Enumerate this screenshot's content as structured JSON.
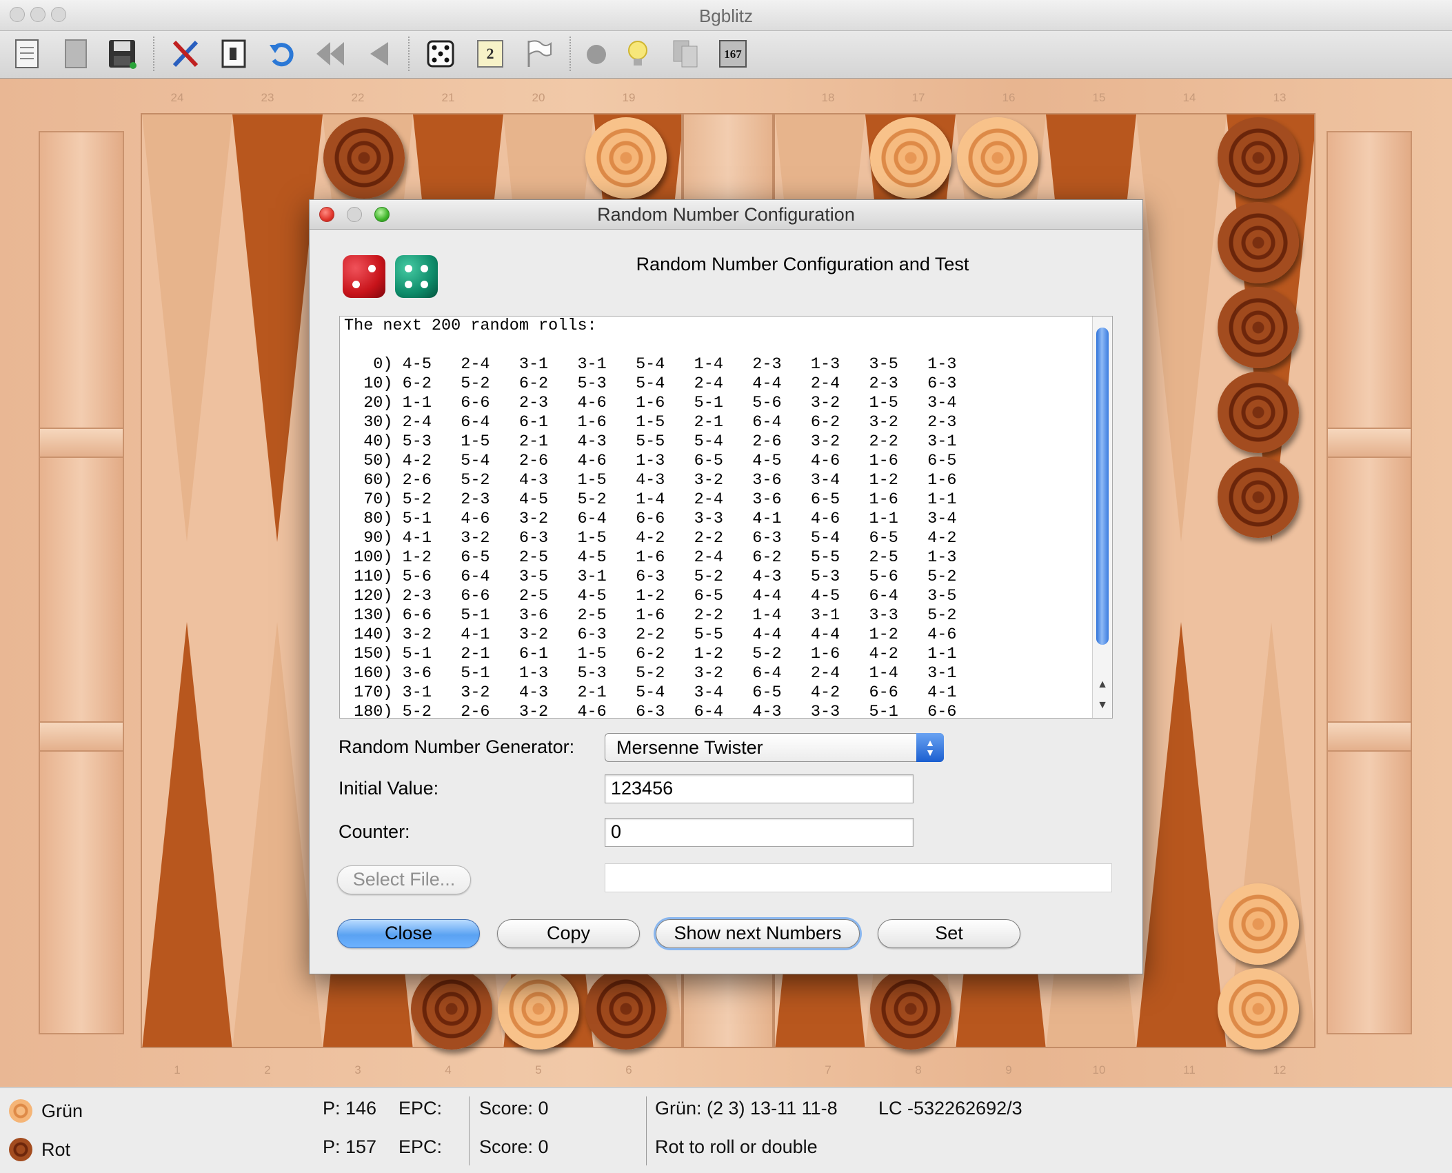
{
  "window": {
    "title": "Bgblitz"
  },
  "toolbar": {
    "items": [
      {
        "icon": "new-document-icon"
      },
      {
        "icon": "open-document-icon"
      },
      {
        "icon": "save-disk-icon"
      },
      {
        "icon": "tools-settings-icon"
      },
      {
        "icon": "board-view-icon"
      },
      {
        "icon": "undo-icon"
      },
      {
        "icon": "rewind-icon"
      },
      {
        "icon": "step-back-icon"
      },
      {
        "icon": "roll-dice-icon"
      },
      {
        "icon": "double-cube-icon",
        "label": "2"
      },
      {
        "icon": "resign-flag-icon"
      },
      {
        "icon": "circle-icon"
      },
      {
        "icon": "hint-lightbulb-icon"
      },
      {
        "icon": "copy-icon"
      },
      {
        "icon": "counter-icon",
        "label": "167"
      }
    ]
  },
  "board": {
    "top_points": [
      "24",
      "23",
      "22",
      "21",
      "20",
      "19",
      "18",
      "17",
      "16",
      "15",
      "14",
      "13"
    ],
    "bottom_points": [
      "1",
      "2",
      "3",
      "4",
      "5",
      "6",
      "7",
      "8",
      "9",
      "10",
      "11",
      "12"
    ],
    "colors": {
      "dark_checker": "#8a3a12",
      "light_checker": "#f0a86a",
      "turn_indicator": "#e0140c"
    }
  },
  "dialog": {
    "title": "Random Number Configuration",
    "heading": "Random Number Configuration and Test",
    "dice": [
      {
        "color": "#c8141b",
        "face": 2,
        "icon": "red-die-icon"
      },
      {
        "color": "#0e8c6a",
        "face": 4,
        "icon": "green-die-icon"
      }
    ],
    "rolls_header": "The next 200 random rolls:",
    "rolls": [
      {
        "index": "  0)",
        "values": [
          "4-5",
          "2-4",
          "3-1",
          "3-1",
          "5-4",
          "1-4",
          "2-3",
          "1-3",
          "3-5",
          "1-3"
        ]
      },
      {
        "index": " 10)",
        "values": [
          "6-2",
          "5-2",
          "6-2",
          "5-3",
          "5-4",
          "2-4",
          "4-4",
          "2-4",
          "2-3",
          "6-3"
        ]
      },
      {
        "index": " 20)",
        "values": [
          "1-1",
          "6-6",
          "2-3",
          "4-6",
          "1-6",
          "5-1",
          "5-6",
          "3-2",
          "1-5",
          "3-4"
        ]
      },
      {
        "index": " 30)",
        "values": [
          "2-4",
          "6-4",
          "6-1",
          "1-6",
          "1-5",
          "2-1",
          "6-4",
          "6-2",
          "3-2",
          "2-3"
        ]
      },
      {
        "index": " 40)",
        "values": [
          "5-3",
          "1-5",
          "2-1",
          "4-3",
          "5-5",
          "5-4",
          "2-6",
          "3-2",
          "2-2",
          "3-1"
        ]
      },
      {
        "index": " 50)",
        "values": [
          "4-2",
          "5-4",
          "2-6",
          "4-6",
          "1-3",
          "6-5",
          "4-5",
          "4-6",
          "1-6",
          "6-5"
        ]
      },
      {
        "index": " 60)",
        "values": [
          "2-6",
          "5-2",
          "4-3",
          "1-5",
          "4-3",
          "3-2",
          "3-6",
          "3-4",
          "1-2",
          "1-6"
        ]
      },
      {
        "index": " 70)",
        "values": [
          "5-2",
          "2-3",
          "4-5",
          "5-2",
          "1-4",
          "2-4",
          "3-6",
          "6-5",
          "1-6",
          "1-1"
        ]
      },
      {
        "index": " 80)",
        "values": [
          "5-1",
          "4-6",
          "3-2",
          "6-4",
          "6-6",
          "3-3",
          "4-1",
          "4-6",
          "1-1",
          "3-4"
        ]
      },
      {
        "index": " 90)",
        "values": [
          "4-1",
          "3-2",
          "6-3",
          "1-5",
          "4-2",
          "2-2",
          "6-3",
          "5-4",
          "6-5",
          "4-2"
        ]
      },
      {
        "index": "100)",
        "values": [
          "1-2",
          "6-5",
          "2-5",
          "4-5",
          "1-6",
          "2-4",
          "6-2",
          "5-5",
          "2-5",
          "1-3"
        ]
      },
      {
        "index": "110)",
        "values": [
          "5-6",
          "6-4",
          "3-5",
          "3-1",
          "6-3",
          "5-2",
          "4-3",
          "5-3",
          "5-6",
          "5-2"
        ]
      },
      {
        "index": "120)",
        "values": [
          "2-3",
          "6-6",
          "2-5",
          "4-5",
          "1-2",
          "6-5",
          "4-4",
          "4-5",
          "6-4",
          "3-5"
        ]
      },
      {
        "index": "130)",
        "values": [
          "6-6",
          "5-1",
          "3-6",
          "2-5",
          "1-6",
          "2-2",
          "1-4",
          "3-1",
          "3-3",
          "5-2"
        ]
      },
      {
        "index": "140)",
        "values": [
          "3-2",
          "4-1",
          "3-2",
          "6-3",
          "2-2",
          "5-5",
          "4-4",
          "4-4",
          "1-2",
          "4-6"
        ]
      },
      {
        "index": "150)",
        "values": [
          "5-1",
          "2-1",
          "6-1",
          "1-5",
          "6-2",
          "1-2",
          "5-2",
          "1-6",
          "4-2",
          "1-1"
        ]
      },
      {
        "index": "160)",
        "values": [
          "3-6",
          "5-1",
          "1-3",
          "5-3",
          "5-2",
          "3-2",
          "6-4",
          "2-4",
          "1-4",
          "3-1"
        ]
      },
      {
        "index": "170)",
        "values": [
          "3-1",
          "3-2",
          "4-3",
          "2-1",
          "5-4",
          "3-4",
          "6-5",
          "4-2",
          "6-6",
          "4-1"
        ]
      },
      {
        "index": "180)",
        "values": [
          "5-2",
          "2-6",
          "3-2",
          "4-6",
          "6-3",
          "6-4",
          "4-3",
          "3-3",
          "5-1",
          "6-6"
        ]
      }
    ],
    "scrollbar": {
      "position_fraction": 0.0
    },
    "rng_label": "Random Number Generator:",
    "rng_value": "Mersenne Twister",
    "initial_value_label": "Initial Value:",
    "initial_value": "123456",
    "counter_label": "Counter:",
    "counter_value": "0",
    "select_file_label": "Select File...",
    "file_path": "",
    "buttons": {
      "close": "Close",
      "copy": "Copy",
      "show_next": "Show next Numbers",
      "set": "Set"
    }
  },
  "status": {
    "player1": {
      "name": "Grün",
      "pips": "P: 146",
      "epc": "EPC:",
      "score": "Score: 0"
    },
    "player2": {
      "name": "Rot",
      "pips": "P: 157",
      "epc": "EPC:",
      "score": "Score: 0"
    },
    "last_move": "Grün: (2 3) 13-11 11-8",
    "lc": "LC -532262692/3",
    "message": "Rot to roll or double"
  }
}
